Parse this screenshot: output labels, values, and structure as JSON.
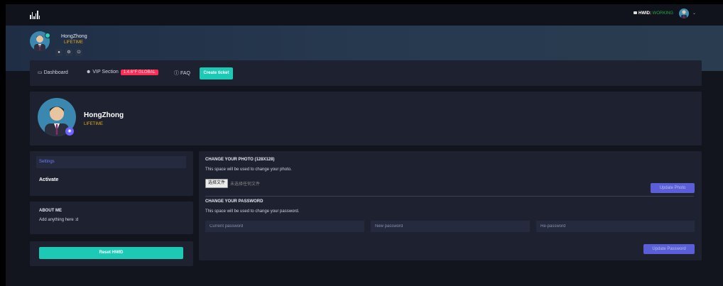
{
  "header": {
    "hwid_label": "HWID:",
    "hwid_status": "WORKING",
    "status_color": "#27a844"
  },
  "banner": {
    "username": "HongZhong",
    "tier": "LIFETIME",
    "icons": [
      "user-icon",
      "gear-icon",
      "power-icon"
    ]
  },
  "nav": {
    "dashboard": "Dashboard",
    "vip": "VIP Section",
    "vip_badge": "1.4.6°F GLOBAL",
    "faq": "FAQ",
    "ticket": "Create ticket"
  },
  "profile": {
    "username": "HongZhong",
    "tier": "LIFETIME"
  },
  "sidebar": {
    "settings": "Settings",
    "activate": "Activate",
    "about_title": "ABOUT ME",
    "about_text": "Add anything here :d",
    "reset": "Reset HWID"
  },
  "photo": {
    "title": "CHANGE YOUR PHOTO (128X128)",
    "desc": "This space will be used to change your photo.",
    "choose": "选择文件",
    "nofile": "未选择任何文件",
    "button": "Update Photo"
  },
  "password": {
    "title": "CHANGE YOUR PASSWORD",
    "desc": "This space will be used to change your password.",
    "current_placeholder": "Current password",
    "new_placeholder": "New password",
    "re_placeholder": "Re-password",
    "button": "Update Password"
  },
  "colors": {
    "accent": "#1bc9b5",
    "primary": "#5a5fd8",
    "tier": "#e6a817",
    "badge": "#ff2d55"
  }
}
